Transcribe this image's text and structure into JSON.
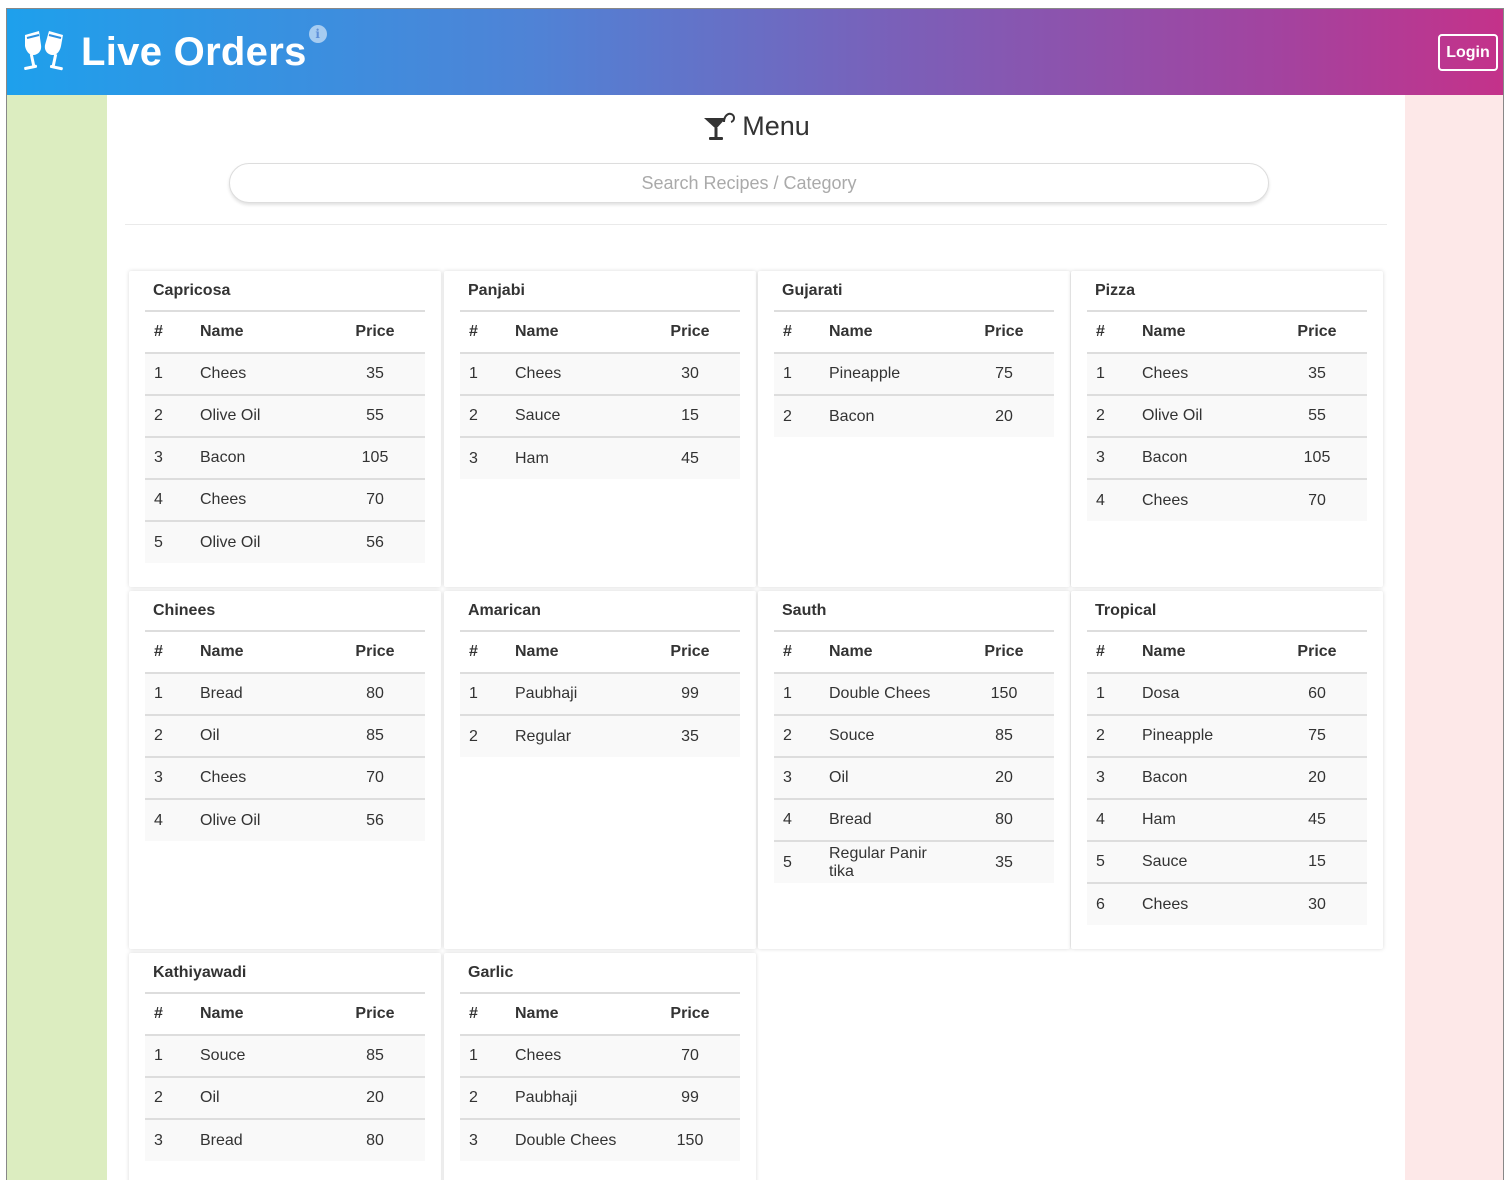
{
  "navbar": {
    "brand_title": "Live Orders",
    "info_glyph": "i",
    "brand_icon": "cheers-icon",
    "login_label": "Login"
  },
  "menu": {
    "heading": "Menu",
    "heading_icon": "cocktail-icon",
    "search_placeholder": "Search Recipes / Category"
  },
  "table_headers": {
    "num": "#",
    "name": "Name",
    "price": "Price"
  },
  "categories": [
    {
      "title": "Capricosa",
      "items": [
        {
          "n": "1",
          "name": "Chees",
          "price": "35"
        },
        {
          "n": "2",
          "name": "Olive Oil",
          "price": "55"
        },
        {
          "n": "3",
          "name": "Bacon",
          "price": "105"
        },
        {
          "n": "4",
          "name": "Chees",
          "price": "70"
        },
        {
          "n": "5",
          "name": "Olive Oil",
          "price": "56"
        }
      ]
    },
    {
      "title": "Panjabi",
      "items": [
        {
          "n": "1",
          "name": "Chees",
          "price": "30"
        },
        {
          "n": "2",
          "name": "Sauce",
          "price": "15"
        },
        {
          "n": "3",
          "name": "Ham",
          "price": "45"
        }
      ]
    },
    {
      "title": "Gujarati",
      "items": [
        {
          "n": "1",
          "name": "Pineapple",
          "price": "75"
        },
        {
          "n": "2",
          "name": "Bacon",
          "price": "20"
        }
      ]
    },
    {
      "title": "Pizza",
      "items": [
        {
          "n": "1",
          "name": "Chees",
          "price": "35"
        },
        {
          "n": "2",
          "name": "Olive Oil",
          "price": "55"
        },
        {
          "n": "3",
          "name": "Bacon",
          "price": "105"
        },
        {
          "n": "4",
          "name": "Chees",
          "price": "70"
        }
      ]
    },
    {
      "title": "Chinees",
      "items": [
        {
          "n": "1",
          "name": "Bread",
          "price": "80"
        },
        {
          "n": "2",
          "name": "Oil",
          "price": "85"
        },
        {
          "n": "3",
          "name": "Chees",
          "price": "70"
        },
        {
          "n": "4",
          "name": "Olive Oil",
          "price": "56"
        }
      ]
    },
    {
      "title": "Amarican",
      "items": [
        {
          "n": "1",
          "name": "Paubhaji",
          "price": "99"
        },
        {
          "n": "2",
          "name": "Regular",
          "price": "35"
        }
      ]
    },
    {
      "title": "Sauth",
      "items": [
        {
          "n": "1",
          "name": "Double Chees",
          "price": "150"
        },
        {
          "n": "2",
          "name": "Souce",
          "price": "85"
        },
        {
          "n": "3",
          "name": "Oil",
          "price": "20"
        },
        {
          "n": "4",
          "name": "Bread",
          "price": "80"
        },
        {
          "n": "5",
          "name": "Regular Panir tika",
          "price": "35"
        }
      ]
    },
    {
      "title": "Tropical",
      "items": [
        {
          "n": "1",
          "name": "Dosa",
          "price": "60"
        },
        {
          "n": "2",
          "name": "Pineapple",
          "price": "75"
        },
        {
          "n": "3",
          "name": "Bacon",
          "price": "20"
        },
        {
          "n": "4",
          "name": "Ham",
          "price": "45"
        },
        {
          "n": "5",
          "name": "Sauce",
          "price": "15"
        },
        {
          "n": "6",
          "name": "Chees",
          "price": "30"
        }
      ]
    },
    {
      "title": "Kathiyawadi",
      "items": [
        {
          "n": "1",
          "name": "Souce",
          "price": "85"
        },
        {
          "n": "2",
          "name": "Oil",
          "price": "20"
        },
        {
          "n": "3",
          "name": "Bread",
          "price": "80"
        }
      ]
    },
    {
      "title": "Garlic",
      "items": [
        {
          "n": "1",
          "name": "Chees",
          "price": "70"
        },
        {
          "n": "2",
          "name": "Paubhaji",
          "price": "99"
        },
        {
          "n": "3",
          "name": "Double Chees",
          "price": "150"
        }
      ]
    }
  ]
}
